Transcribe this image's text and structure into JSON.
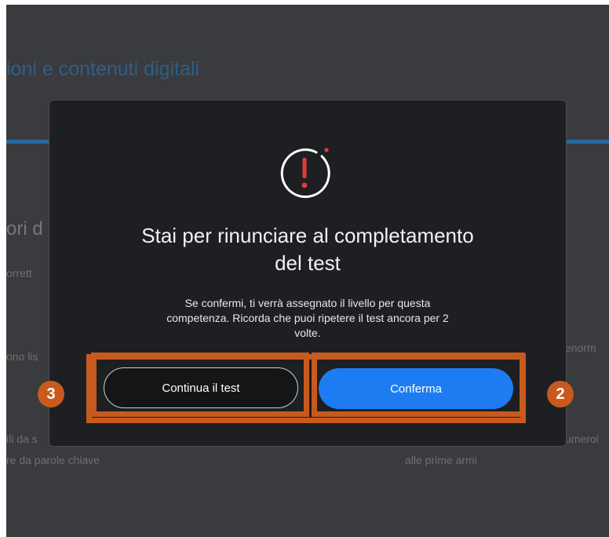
{
  "background": {
    "heading": "ioni e contenuti digitali",
    "fragments": [
      "ori d",
      "orrett",
      "ono lis",
      "enorm",
      "ili da s",
      "umeroi",
      "re da parole chiave",
      "alle prime armi"
    ]
  },
  "modal": {
    "icon": "alert-exclamation-icon",
    "title_line1": "Stai per rinunciare al completamento",
    "title_line2": "del test",
    "body_line1": "Se confermi, ti verrà assegnato il livello per questa",
    "body_line2": "competenza. Ricorda che puoi ripetere il test ancora per 2",
    "body_line3": "volte.",
    "continue_label": "Continua il test",
    "confirm_label": "Conferma"
  },
  "annotations": {
    "left_step": "3",
    "right_step": "2",
    "color": "#c85a1d"
  },
  "colors": {
    "confirm_button": "#1d7cf2",
    "alert_accent": "#e23b3b",
    "modal_bg": "#1e1f22"
  }
}
